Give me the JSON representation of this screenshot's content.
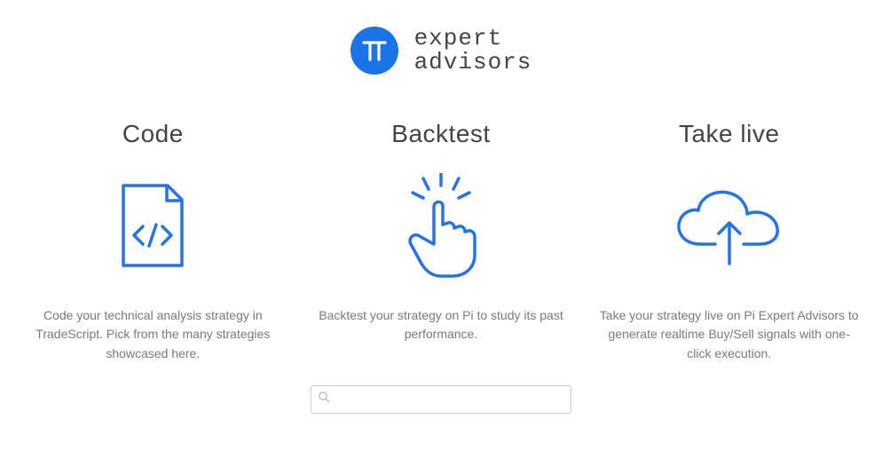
{
  "brand": {
    "line1": "expert",
    "line2": "advisors"
  },
  "features": [
    {
      "title": "Code",
      "description": "Code your technical analysis strategy in TradeScript. Pick from the many strategies showcased here."
    },
    {
      "title": "Backtest",
      "description": "Backtest your strategy on Pi to study its past performance."
    },
    {
      "title": "Take live",
      "description": "Take your strategy live on Pi Expert Advisors to generate realtime Buy/Sell signals with one-click execution."
    }
  ],
  "search": {
    "placeholder": ""
  }
}
